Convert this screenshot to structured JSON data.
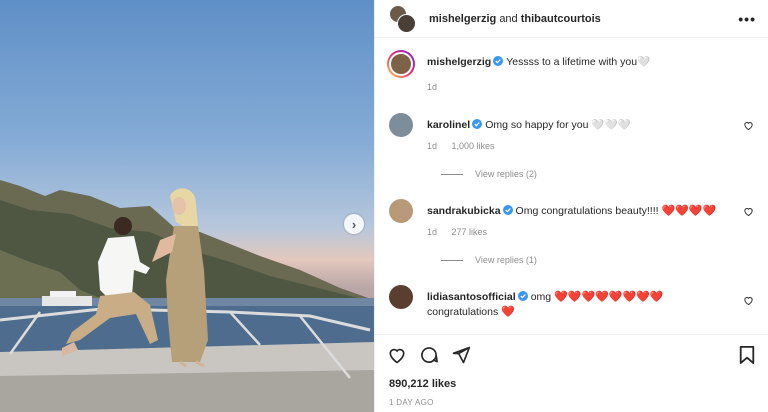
{
  "header": {
    "user1": "mishelgerzig",
    "joiner": "and",
    "user2": "thibautcourtois"
  },
  "colors": {
    "verified": "#3897f0",
    "heart": "#e0245e",
    "muted": "#8e8e8e"
  },
  "caption": {
    "username": "mishelgerzig",
    "text": "Yessss to a lifetime with you",
    "trailing_glyph": "🤍",
    "time": "1d"
  },
  "comments": [
    {
      "username": "karolinel",
      "text": "Omg so happy for you",
      "emoji": "🤍🤍🤍",
      "time": "1d",
      "likes": "1,000 likes",
      "replies": "View replies (2)"
    },
    {
      "username": "sandrakubicka",
      "text": "Omg congratulations beauty!!!!",
      "emoji": "❤️❤️❤️❤️",
      "time": "1d",
      "likes": "277 likes",
      "replies": "View replies (1)"
    },
    {
      "username": "lidiasantosofficial",
      "text": "omg",
      "emoji": "❤️❤️❤️❤️❤️❤️❤️❤️",
      "line2": "congratulations",
      "emoji2": "❤️"
    }
  ],
  "post": {
    "likes": "890,212 likes",
    "posted": "1 DAY AGO"
  },
  "icons": [
    "more-icon",
    "heart-icon",
    "comment-icon",
    "share-icon",
    "bookmark-icon",
    "next-arrow-icon",
    "verified-icon"
  ]
}
